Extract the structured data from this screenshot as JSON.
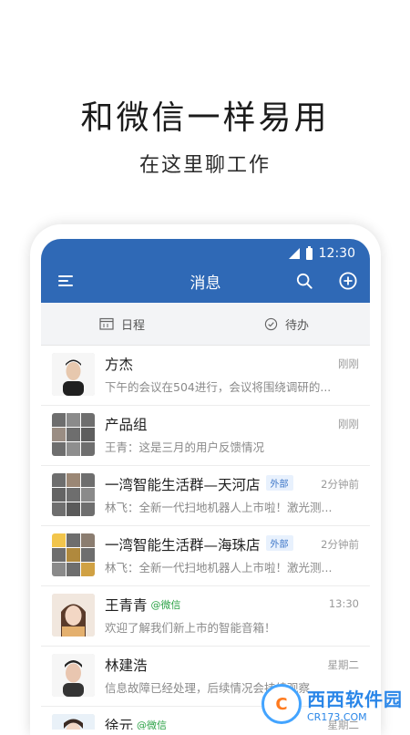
{
  "hero": {
    "title": "和微信一样易用",
    "subtitle": "在这里聊工作"
  },
  "status_bar": {
    "time": "12:30"
  },
  "app_bar": {
    "title": "消息",
    "icons": [
      "menu-icon",
      "search-icon",
      "plus-circle-icon"
    ]
  },
  "tabs": [
    {
      "label": "日程",
      "icon": "calendar-icon"
    },
    {
      "label": "待办",
      "icon": "check-circle-icon"
    }
  ],
  "conversations": [
    {
      "name": "方杰",
      "message": "下午的会议在504进行，会议将围绕调研的...",
      "time": "刚刚",
      "tag": ""
    },
    {
      "name": "产品组",
      "message": "王青：这是三月的用户反馈情况",
      "time": "刚刚",
      "tag": ""
    },
    {
      "name": "一湾智能生活群—天河店",
      "message": "林飞：全新一代扫地机器人上市啦！激光测...",
      "time": "2分钟前",
      "tag": "外部"
    },
    {
      "name": "一湾智能生活群—海珠店",
      "message": "林飞：全新一代扫地机器人上市啦！激光测...",
      "time": "2分钟前",
      "tag": "外部"
    },
    {
      "name": "王青青",
      "message": "欢迎了解我们新上市的智能音箱！",
      "time": "13:30",
      "tag": "@微信"
    },
    {
      "name": "林建浩",
      "message": "信息故障已经处理，后续情况会持续观察",
      "time": "星期二",
      "tag": ""
    },
    {
      "name": "徐元",
      "message": "",
      "time": "星期二",
      "tag": "@微信"
    }
  ],
  "watermark": {
    "brand": "西西软件园",
    "url": "CR173.COM",
    "logo_text": "C"
  },
  "colors": {
    "brand_blue": "#2f69b6",
    "wechat_green": "#2ba245",
    "external_tag": "#3c76c8"
  }
}
